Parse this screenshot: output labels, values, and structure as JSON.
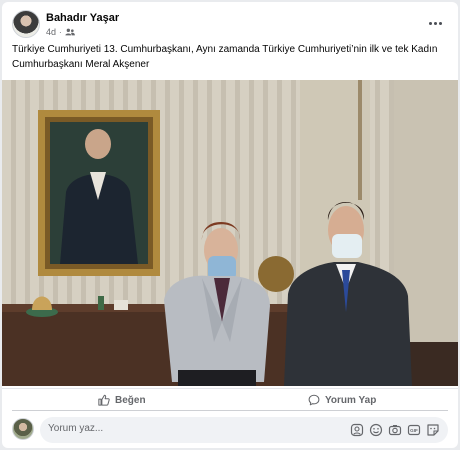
{
  "post": {
    "author": "Bahadır Yaşar",
    "time": "4d",
    "separator": "·",
    "audience_icon": "friends-icon",
    "caption": "Türkiye Cumhuriyeti 13. Cumhurbaşkanı, Aynı zamanda Türkiye Cumhuriyeti’nin ilk ve tek Kadın Cumhurbaşkanı Meral Akşener"
  },
  "actions": {
    "like_label": "Beğen",
    "comment_label": "Yorum Yap"
  },
  "comment_box": {
    "placeholder": "Yorum yaz..."
  },
  "icons": {
    "more": "more-options-icon",
    "like": "thumbs-up-icon",
    "comment": "comment-bubble-icon",
    "sticker": "sticker-icon",
    "emoji": "emoji-icon",
    "camera": "camera-icon",
    "gif": "gif-icon",
    "avatar_sticker": "avatar-sticker-icon"
  },
  "colors": {
    "text_primary": "#050505",
    "text_secondary": "#65676b",
    "input_bg": "#f0f2f5"
  }
}
